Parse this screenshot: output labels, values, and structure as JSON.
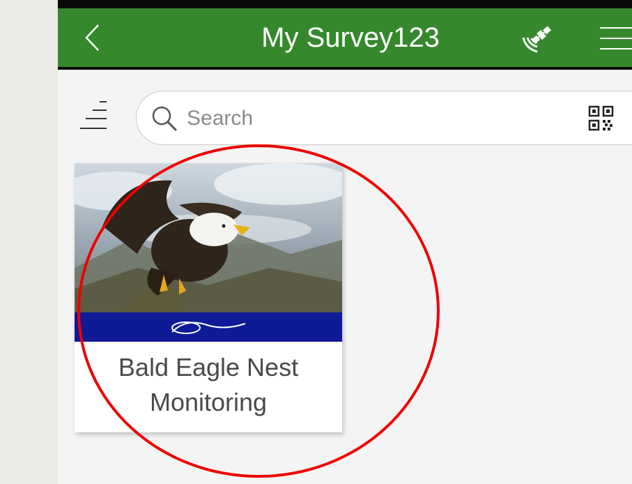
{
  "app": {
    "title": "My Survey123",
    "back_icon": "chevron-left-icon",
    "satellite_icon": "satellite-icon",
    "menu_icon": "hamburger-menu-icon",
    "header_color": "#35892c"
  },
  "toolbar": {
    "sort_icon": "sort-icon",
    "search": {
      "placeholder": "Search",
      "value": ""
    },
    "qr_icon": "qr-code-icon"
  },
  "surveys": [
    {
      "title_line1": "Bald Eagle Nest",
      "title_line2": "Monitoring",
      "thumbnail": "bald-eagle-photo",
      "banner_text": "City of Solon",
      "banner_color": "#0e1a96"
    }
  ],
  "annotation": {
    "shape": "circle",
    "color": "#ee0000"
  }
}
